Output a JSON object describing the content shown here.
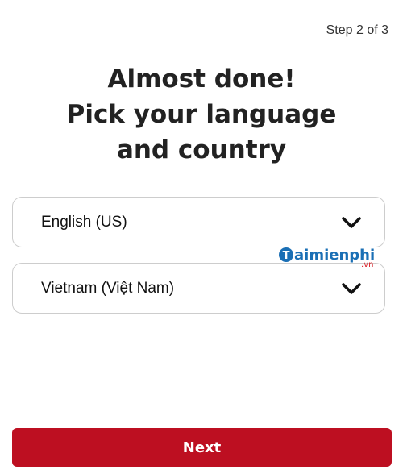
{
  "header": {
    "step_label": "Step 2 of 3"
  },
  "main": {
    "title_lines": [
      "Almost done!",
      "Pick your language",
      "and country"
    ],
    "language_select": {
      "selected": "English (US)",
      "icon": "chevron-down-icon"
    },
    "country_select": {
      "selected": "Vietnam (Việt Nam)",
      "icon": "chevron-down-icon"
    }
  },
  "watermark": {
    "brand": "aimienphi",
    "suffix": ".vn"
  },
  "footer": {
    "next_label": "Next"
  },
  "colors": {
    "primary_button": "#bd0f21",
    "watermark_blue": "#1a6fb5",
    "watermark_red": "#d92027"
  }
}
